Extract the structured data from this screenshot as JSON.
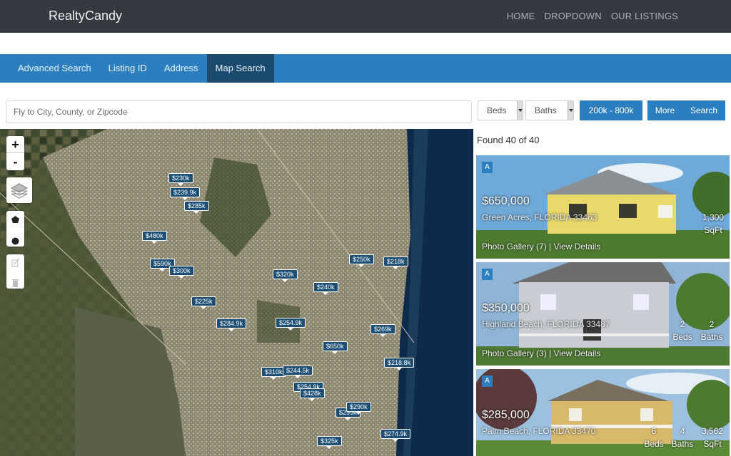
{
  "header": {
    "brand": "RealtyCandy",
    "nav": [
      "HOME",
      "DROPDOWN",
      "OUR LISTINGS"
    ]
  },
  "tabs": [
    {
      "label": "Advanced Search",
      "active": false
    },
    {
      "label": "Listing ID",
      "active": false
    },
    {
      "label": "Address",
      "active": false
    },
    {
      "label": "Map Search",
      "active": true
    }
  ],
  "search": {
    "placeholder": "Fly to City, County, or Zipcode",
    "value": "",
    "beds": "Beds",
    "baths": "Baths",
    "price_range": "200k - 800k",
    "more": "More",
    "submit": "Search"
  },
  "map": {
    "zoom_in": "+",
    "zoom_out": "-",
    "markers": [
      "$230k",
      "$239.9k",
      "$285k",
      "$480k",
      "$590k",
      "$300k",
      "$250k",
      "$218k",
      "$320k",
      "$240k",
      "$225k",
      "$284.9k",
      "$254.9k",
      "$269k",
      "$650k",
      "$218.8k",
      "$310k",
      "$244.5k",
      "$254.9k",
      "$428k",
      "$299k",
      "$290k",
      "$325k",
      "$274.9k"
    ]
  },
  "results": {
    "count_text": "Found 40 of 40",
    "listings": [
      {
        "badge": "A",
        "price": "$650,000",
        "address": "Green Acres, FLORIDA 33463",
        "links": "Photo Gallery (7) | View Details",
        "stats": [
          {
            "value": "1,300",
            "label": "SqFt"
          }
        ]
      },
      {
        "badge": "A",
        "price": "$350,000",
        "address": "Highland Beach, FLORIDA 33487",
        "links": "Photo Gallery (3) | View Details",
        "stats": [
          {
            "value": "2",
            "label": "Beds"
          },
          {
            "value": "2",
            "label": "Baths"
          }
        ]
      },
      {
        "badge": "A",
        "price": "$285,000",
        "address": "Palm Beach, FLORIDA 33470",
        "links": "",
        "stats": [
          {
            "value": "6",
            "label": "Beds"
          },
          {
            "value": "4",
            "label": "Baths"
          },
          {
            "value": "3,562",
            "label": "SqFt"
          }
        ]
      }
    ]
  },
  "colors": {
    "topbar": "#343a40",
    "accent": "#2b7fc0",
    "active_tab": "#1a4a6e",
    "marker": "#1d4f75"
  }
}
